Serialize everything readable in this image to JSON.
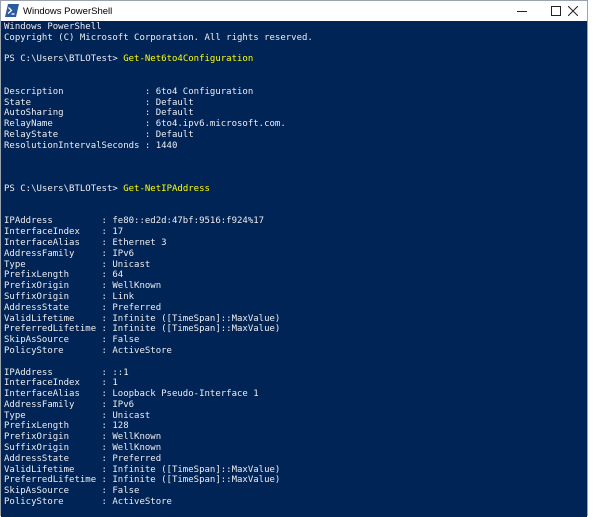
{
  "window": {
    "title": "Windows PowerShell",
    "icon": "powershell-icon"
  },
  "console": {
    "header_1": "Windows PowerShell",
    "header_2": "Copyright (C) Microsoft Corporation. All rights reserved.",
    "prompt": "PS C:\\Users\\BTLOTest> ",
    "cmd1": "Get-Net6to4Configuration",
    "cmd2": "Get-NetIPAddress",
    "net6to4": [
      "Description               : 6to4 Configuration",
      "State                     : Default",
      "AutoSharing               : Default",
      "RelayName                 : 6to4.ipv6.microsoft.com.",
      "RelayState                : Default",
      "ResolutionIntervalSeconds : 1440"
    ],
    "ip1": [
      "IPAddress         : fe80::ed2d:47bf:9516:f924%17",
      "InterfaceIndex    : 17",
      "InterfaceAlias    : Ethernet 3",
      "AddressFamily     : IPv6",
      "Type              : Unicast",
      "PrefixLength      : 64",
      "PrefixOrigin      : WellKnown",
      "SuffixOrigin      : Link",
      "AddressState      : Preferred",
      "ValidLifetime     : Infinite ([TimeSpan]::MaxValue)",
      "PreferredLifetime : Infinite ([TimeSpan]::MaxValue)",
      "SkipAsSource      : False",
      "PolicyStore       : ActiveStore"
    ],
    "ip2": [
      "IPAddress         : ::1",
      "InterfaceIndex    : 1",
      "InterfaceAlias    : Loopback Pseudo-Interface 1",
      "AddressFamily     : IPv6",
      "Type              : Unicast",
      "PrefixLength      : 128",
      "PrefixOrigin      : WellKnown",
      "SuffixOrigin      : WellKnown",
      "AddressState      : Preferred",
      "ValidLifetime     : Infinite ([TimeSpan]::MaxValue)",
      "PreferredLifetime : Infinite ([TimeSpan]::MaxValue)",
      "SkipAsSource      : False",
      "PolicyStore       : ActiveStore"
    ]
  },
  "colors": {
    "background": "#012456",
    "text": "#eeedf0",
    "command": "#fefe00"
  }
}
